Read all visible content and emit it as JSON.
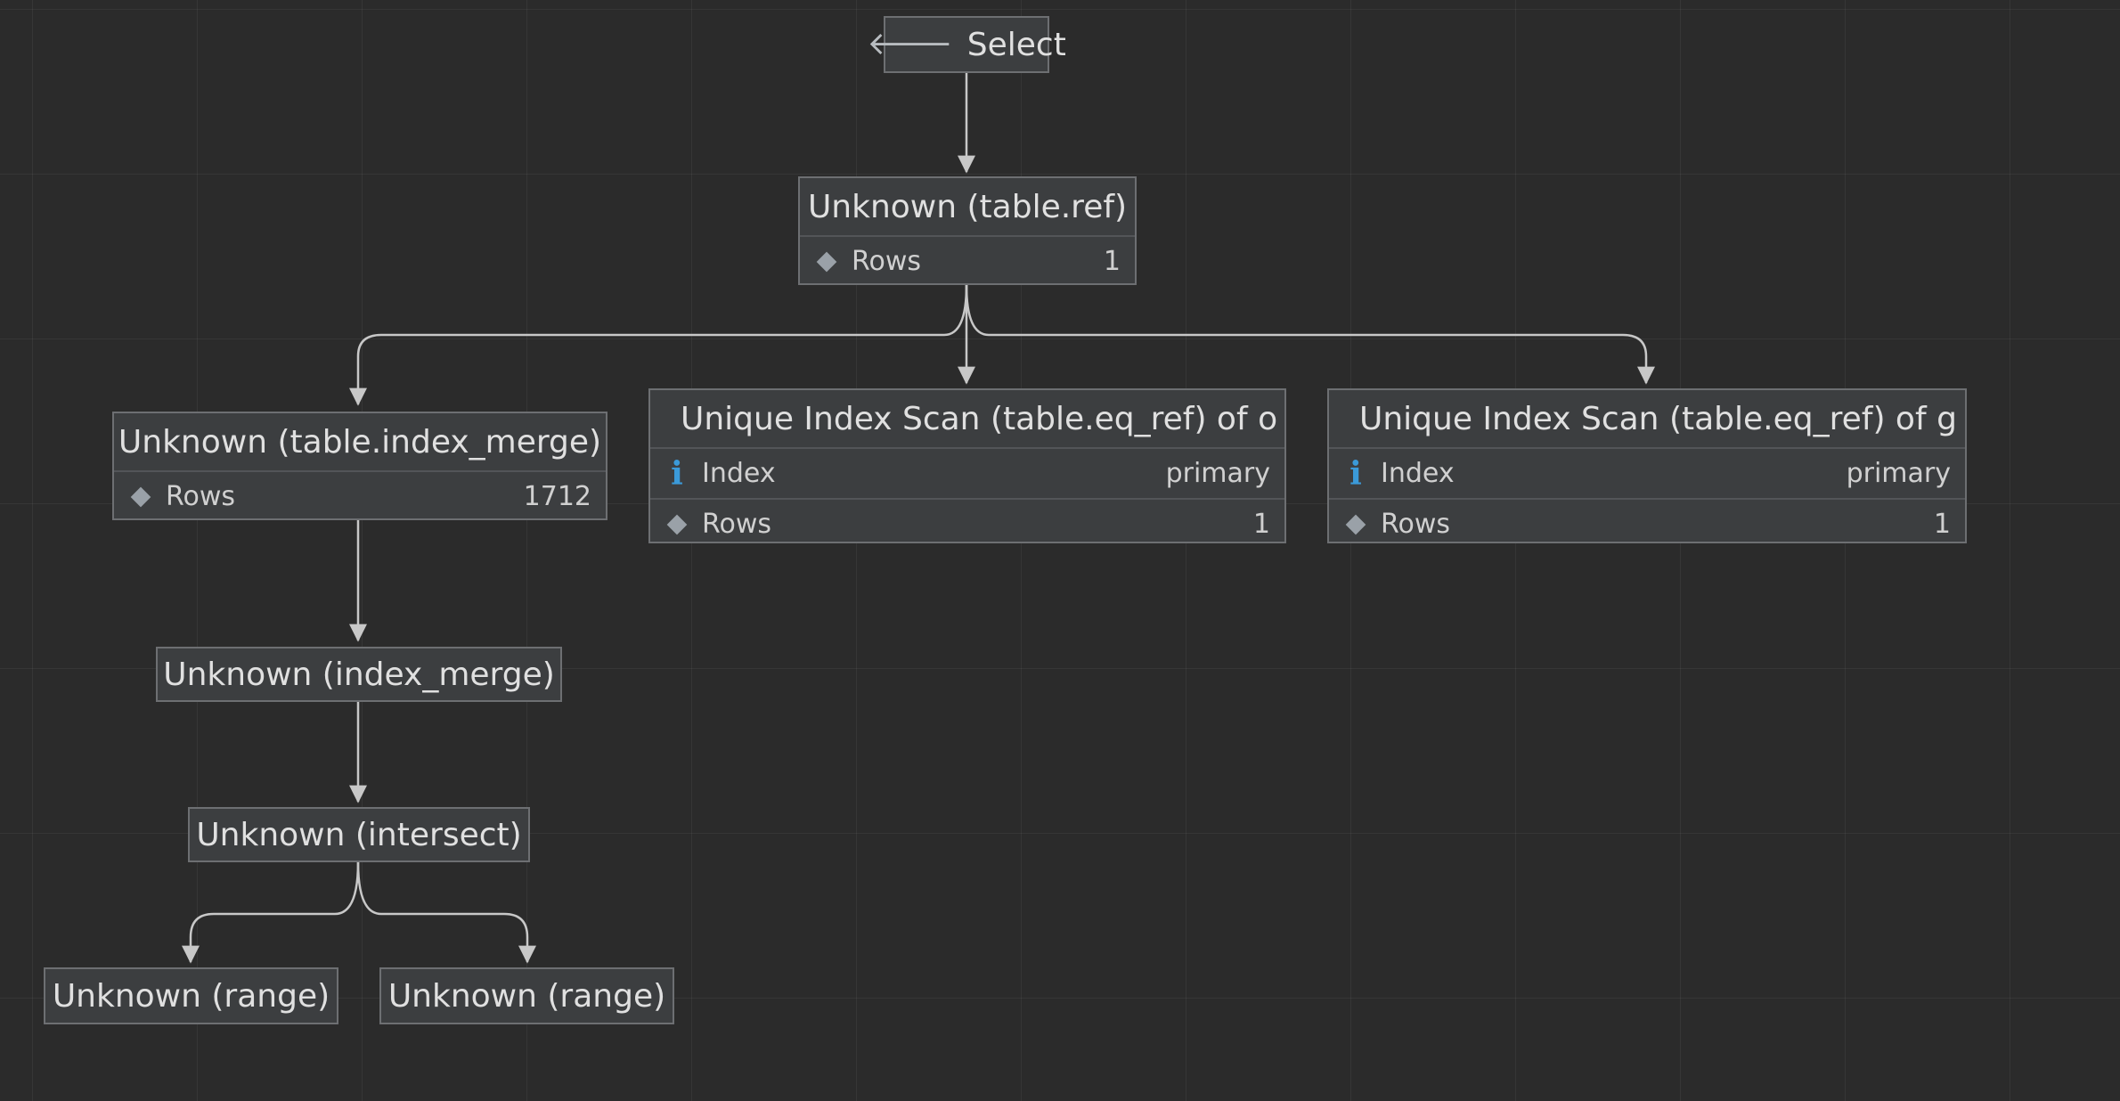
{
  "nodes": {
    "select": {
      "title": "Select",
      "icon": "left-arrow-icon"
    },
    "table_ref": {
      "title": "Unknown (table.ref)",
      "rows_label": "Rows",
      "rows_value": "1"
    },
    "index_merge_table": {
      "title": "Unknown (table.index_merge)",
      "rows_label": "Rows",
      "rows_value": "1712"
    },
    "scan_o": {
      "title": "Unique Index Scan (table.eq_ref) of o",
      "icon": "key-icon",
      "index_label": "Index",
      "index_value": "primary",
      "rows_label": "Rows",
      "rows_value": "1"
    },
    "scan_g": {
      "title": "Unique Index Scan (table.eq_ref) of g",
      "icon": "key-icon",
      "index_label": "Index",
      "index_value": "primary",
      "rows_label": "Rows",
      "rows_value": "1"
    },
    "index_merge": {
      "title": "Unknown (index_merge)"
    },
    "intersect": {
      "title": "Unknown (intersect)"
    },
    "range_left": {
      "title": "Unknown (range)"
    },
    "range_right": {
      "title": "Unknown (range)"
    }
  },
  "colors": {
    "background": "#2b2b2b",
    "node_fill": "#3c3e40",
    "node_border": "#6d6f72",
    "edge": "#c8c8c8",
    "key": "#e0a030",
    "info": "#3b9ad9"
  }
}
